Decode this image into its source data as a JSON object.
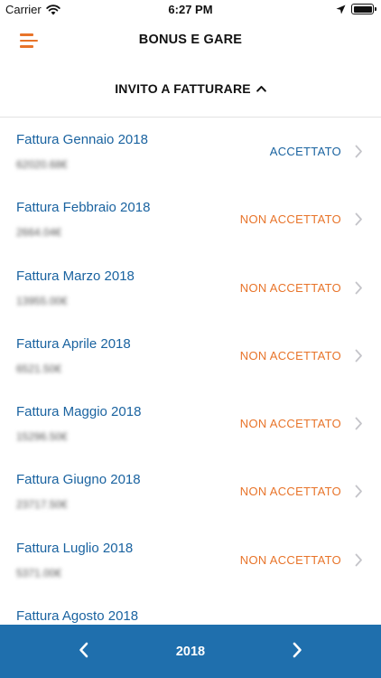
{
  "status_bar": {
    "carrier": "Carrier",
    "time": "6:27 PM"
  },
  "nav": {
    "title": "BONUS E GARE",
    "menu_icon": "hamburger-menu-icon"
  },
  "section": {
    "title": "INVITO A FATTURARE",
    "toggle_icon": "chevron-up-icon"
  },
  "colors": {
    "accent_orange": "#e8742a",
    "link_blue": "#1a63a0",
    "bottom_bar": "#1f6fad"
  },
  "items": [
    {
      "title": "Fattura Gennaio 2018",
      "amount": "62020.68€",
      "status": "ACCETTATO",
      "status_color": "#1a63a0"
    },
    {
      "title": "Fattura Febbraio 2018",
      "amount": "2664.04€",
      "status": "NON ACCETTATO",
      "status_color": "#e8742a"
    },
    {
      "title": "Fattura Marzo 2018",
      "amount": "13955.00€",
      "status": "NON ACCETTATO",
      "status_color": "#e8742a"
    },
    {
      "title": "Fattura Aprile 2018",
      "amount": "6521.50€",
      "status": "NON ACCETTATO",
      "status_color": "#e8742a"
    },
    {
      "title": "Fattura Maggio 2018",
      "amount": "15296.50€",
      "status": "NON ACCETTATO",
      "status_color": "#e8742a"
    },
    {
      "title": "Fattura Giugno 2018",
      "amount": "23717.50€",
      "status": "NON ACCETTATO",
      "status_color": "#e8742a"
    },
    {
      "title": "Fattura Luglio 2018",
      "amount": "5371.00€",
      "status": "NON ACCETTATO",
      "status_color": "#e8742a"
    },
    {
      "title": "Fattura Agosto 2018",
      "amount": "",
      "status": "",
      "status_color": "#e8742a"
    }
  ],
  "bottom_bar": {
    "year": "2018",
    "prev_icon": "chevron-left-icon",
    "next_icon": "chevron-right-icon"
  }
}
